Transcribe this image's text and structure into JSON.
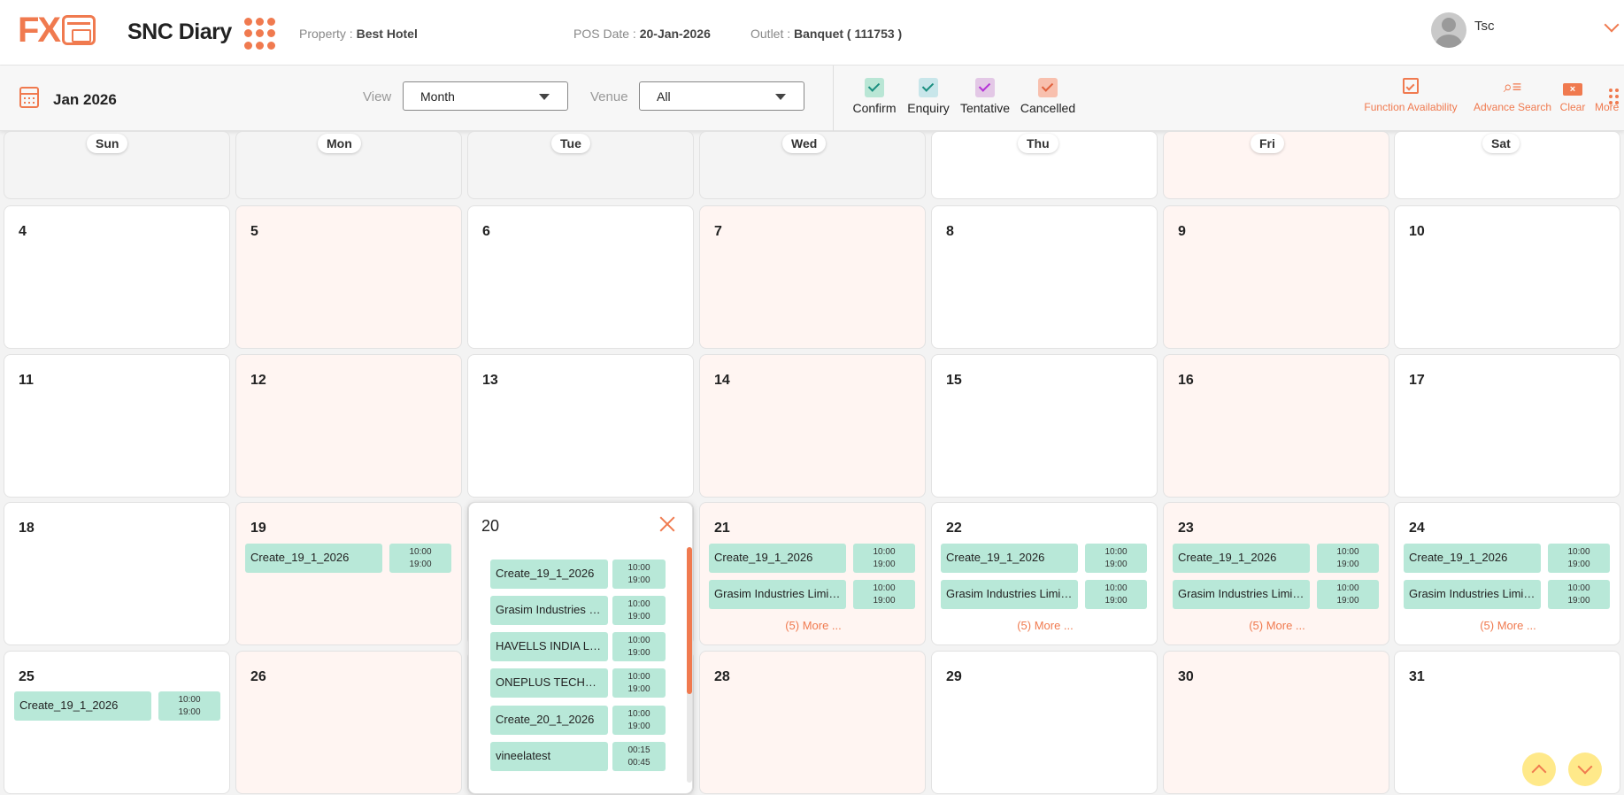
{
  "header": {
    "logo_text": "FX",
    "app_title": "SNC Diary",
    "property_label": "Property :",
    "property_value": "Best Hotel",
    "pos_date_label": "POS Date :",
    "pos_date_value": "20-Jan-2026",
    "outlet_label": "Outlet :",
    "outlet_value": "Banquet ( 111753 )",
    "user_name": "Tsc"
  },
  "toolbar": {
    "month": "Jan 2026",
    "view_label": "View",
    "view_value": "Month",
    "venue_label": "Venue",
    "venue_value": "All",
    "legend": [
      "Confirm",
      "Enquiry",
      "Tentative",
      "Cancelled"
    ],
    "actions": [
      "Function Availability",
      "Advance Search",
      "Clear",
      "More"
    ],
    "clear_glyph": "×"
  },
  "calendar": {
    "day_names": [
      "Sun",
      "Mon",
      "Tue",
      "Wed",
      "Thu",
      "Fri",
      "Sat"
    ],
    "dates": [
      "4",
      "5",
      "6",
      "7",
      "8",
      "9",
      "10",
      "11",
      "12",
      "13",
      "14",
      "15",
      "16",
      "17",
      "18",
      "19",
      "21",
      "22",
      "23",
      "24",
      "25",
      "26",
      "28",
      "29",
      "30",
      "31"
    ],
    "event_create_19": "Create_19_1_2026",
    "event_grasim": "Grasim Industries Limited",
    "time_start": "10:00",
    "time_end": "19:00",
    "more_text": "(5) More ..."
  },
  "popup": {
    "day": "20",
    "events": [
      {
        "name": "Create_19_1_2026",
        "start": "10:00",
        "end": "19:00"
      },
      {
        "name": "Grasim Industries Li...",
        "start": "10:00",
        "end": "19:00"
      },
      {
        "name": "HAVELLS INDIA LIM...",
        "start": "10:00",
        "end": "19:00"
      },
      {
        "name": "ONEPLUS TECHNO...",
        "start": "10:00",
        "end": "19:00"
      },
      {
        "name": "Create_20_1_2026",
        "start": "10:00",
        "end": "19:00"
      },
      {
        "name": "vineelatest",
        "start": "00:15",
        "end": "00:45"
      }
    ]
  },
  "colors": {
    "accent": "#f07a4f",
    "event": "#b8e8d8",
    "weekend_tint": "#fff5f2"
  }
}
